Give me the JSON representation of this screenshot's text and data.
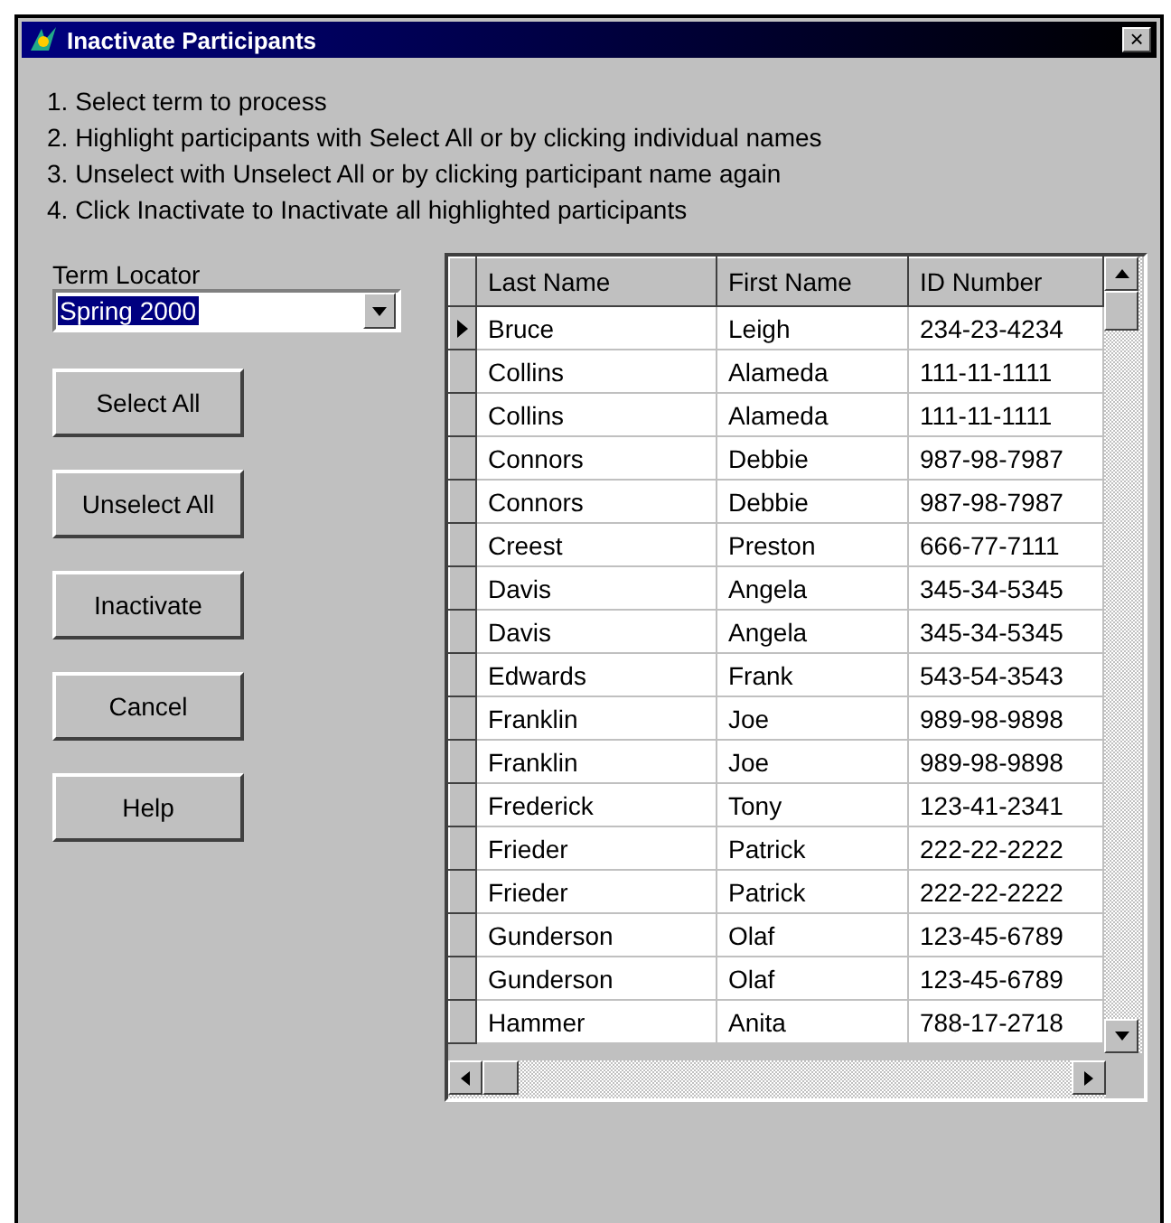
{
  "window": {
    "title": "Inactivate Participants",
    "close": "×"
  },
  "instructions": [
    "1. Select term to process",
    "2. Highlight participants with Select All or by clicking individual names",
    "3. Unselect with Unselect All or by clicking participant name again",
    "4. Click Inactivate to Inactivate all highlighted participants"
  ],
  "term_locator": {
    "label": "Term Locator",
    "value": "Spring 2000"
  },
  "buttons": [
    "Select All",
    "Unselect All",
    "Inactivate",
    "Cancel",
    "Help"
  ],
  "table": {
    "columns": [
      "Last Name",
      "First Name",
      "ID Number"
    ],
    "rows": [
      {
        "cells": [
          "Bruce",
          "Leigh",
          "234-23-4234"
        ],
        "current": true
      },
      {
        "cells": [
          "Collins",
          "Alameda",
          "111-11-1111"
        ],
        "current": false
      },
      {
        "cells": [
          "Collins",
          "Alameda",
          "111-11-1111"
        ],
        "current": false
      },
      {
        "cells": [
          "Connors",
          "Debbie",
          "987-98-7987"
        ],
        "current": false
      },
      {
        "cells": [
          "Connors",
          "Debbie",
          "987-98-7987"
        ],
        "current": false
      },
      {
        "cells": [
          "Creest",
          "Preston",
          "666-77-7111"
        ],
        "current": false
      },
      {
        "cells": [
          "Davis",
          "Angela",
          "345-34-5345"
        ],
        "current": false
      },
      {
        "cells": [
          "Davis",
          "Angela",
          "345-34-5345"
        ],
        "current": false
      },
      {
        "cells": [
          "Edwards",
          "Frank",
          "543-54-3543"
        ],
        "current": false
      },
      {
        "cells": [
          "Franklin",
          "Joe",
          "989-98-9898"
        ],
        "current": false
      },
      {
        "cells": [
          "Franklin",
          "Joe",
          "989-98-9898"
        ],
        "current": false
      },
      {
        "cells": [
          "Frederick",
          "Tony",
          "123-41-2341"
        ],
        "current": false
      },
      {
        "cells": [
          "Frieder",
          "Patrick",
          "222-22-2222"
        ],
        "current": false
      },
      {
        "cells": [
          "Frieder",
          "Patrick",
          "222-22-2222"
        ],
        "current": false
      },
      {
        "cells": [
          "Gunderson",
          "Olaf",
          "123-45-6789"
        ],
        "current": false
      },
      {
        "cells": [
          "Gunderson",
          "Olaf",
          "123-45-6789"
        ],
        "current": false
      },
      {
        "cells": [
          "Hammer",
          "Anita",
          "788-17-2718"
        ],
        "current": false
      }
    ]
  }
}
